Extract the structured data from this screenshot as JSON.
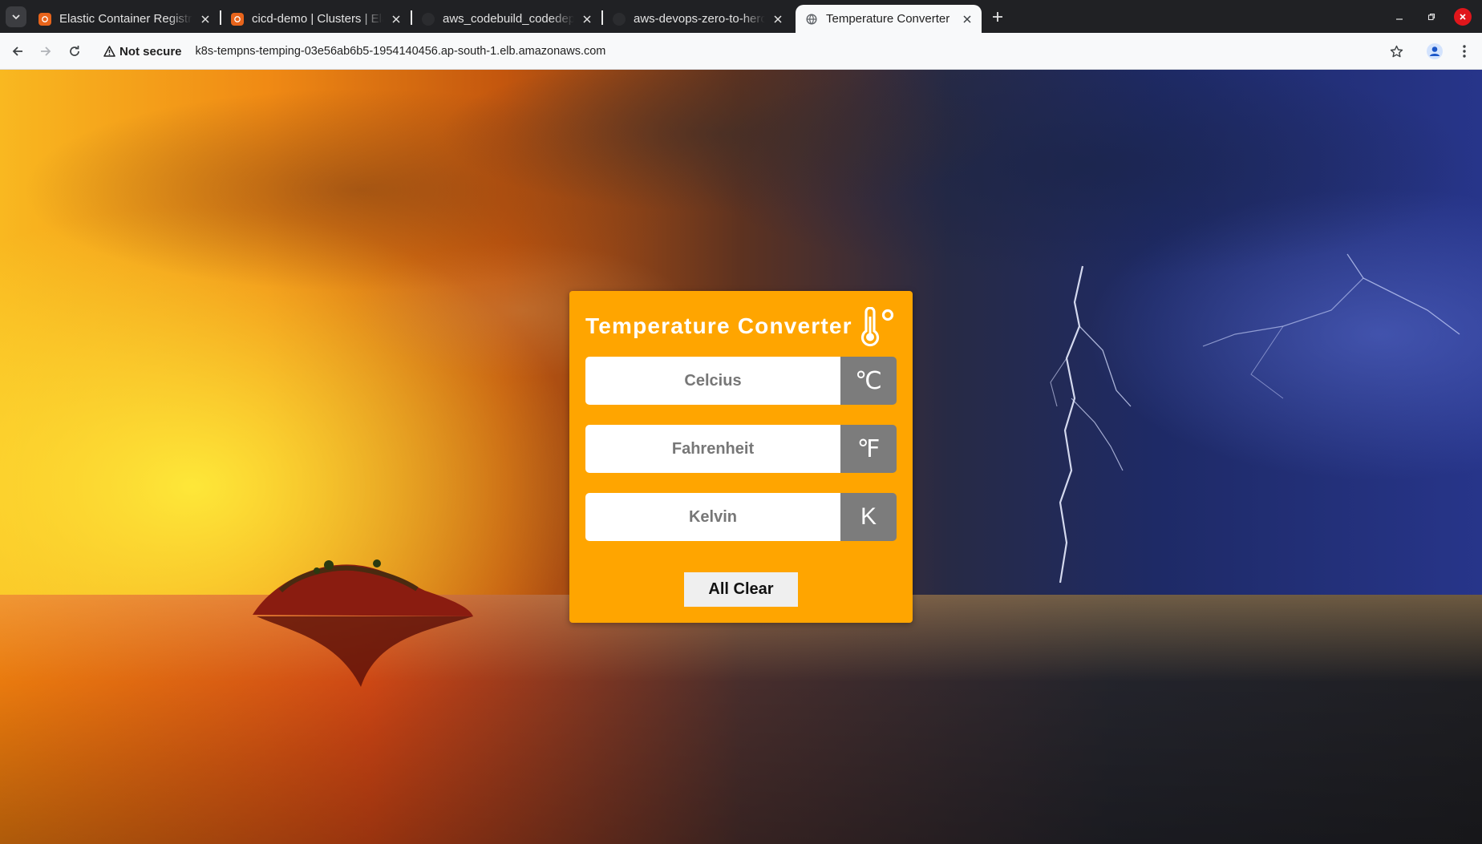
{
  "browser": {
    "tabs": [
      {
        "title": "Elastic Container Registry",
        "favicon": "aws-icon"
      },
      {
        "title": "cicd-demo | Clusters | Elastic Kubernetes Service",
        "favicon": "aws-icon"
      },
      {
        "title": "aws_codebuild_codedeploy",
        "favicon": "github-icon"
      },
      {
        "title": "aws-devops-zero-to-hero",
        "favicon": "github-icon"
      },
      {
        "title": "Temperature Converter",
        "favicon": "globe-icon"
      }
    ],
    "security_label": "Not secure",
    "url": "k8s-tempns-temping-03e56ab6b5-1954140456.ap-south-1.elb.amazonaws.com"
  },
  "converter": {
    "title": "Temperature Converter",
    "celsius": {
      "placeholder": "Celcius",
      "unit": "℃"
    },
    "fahrenheit": {
      "placeholder": "Fahrenheit",
      "unit": "℉"
    },
    "kelvin": {
      "placeholder": "Kelvin",
      "unit": "K"
    },
    "clear_label": "All Clear"
  },
  "colors": {
    "card": "#ffa500",
    "unit_box": "#7c7c7c"
  }
}
